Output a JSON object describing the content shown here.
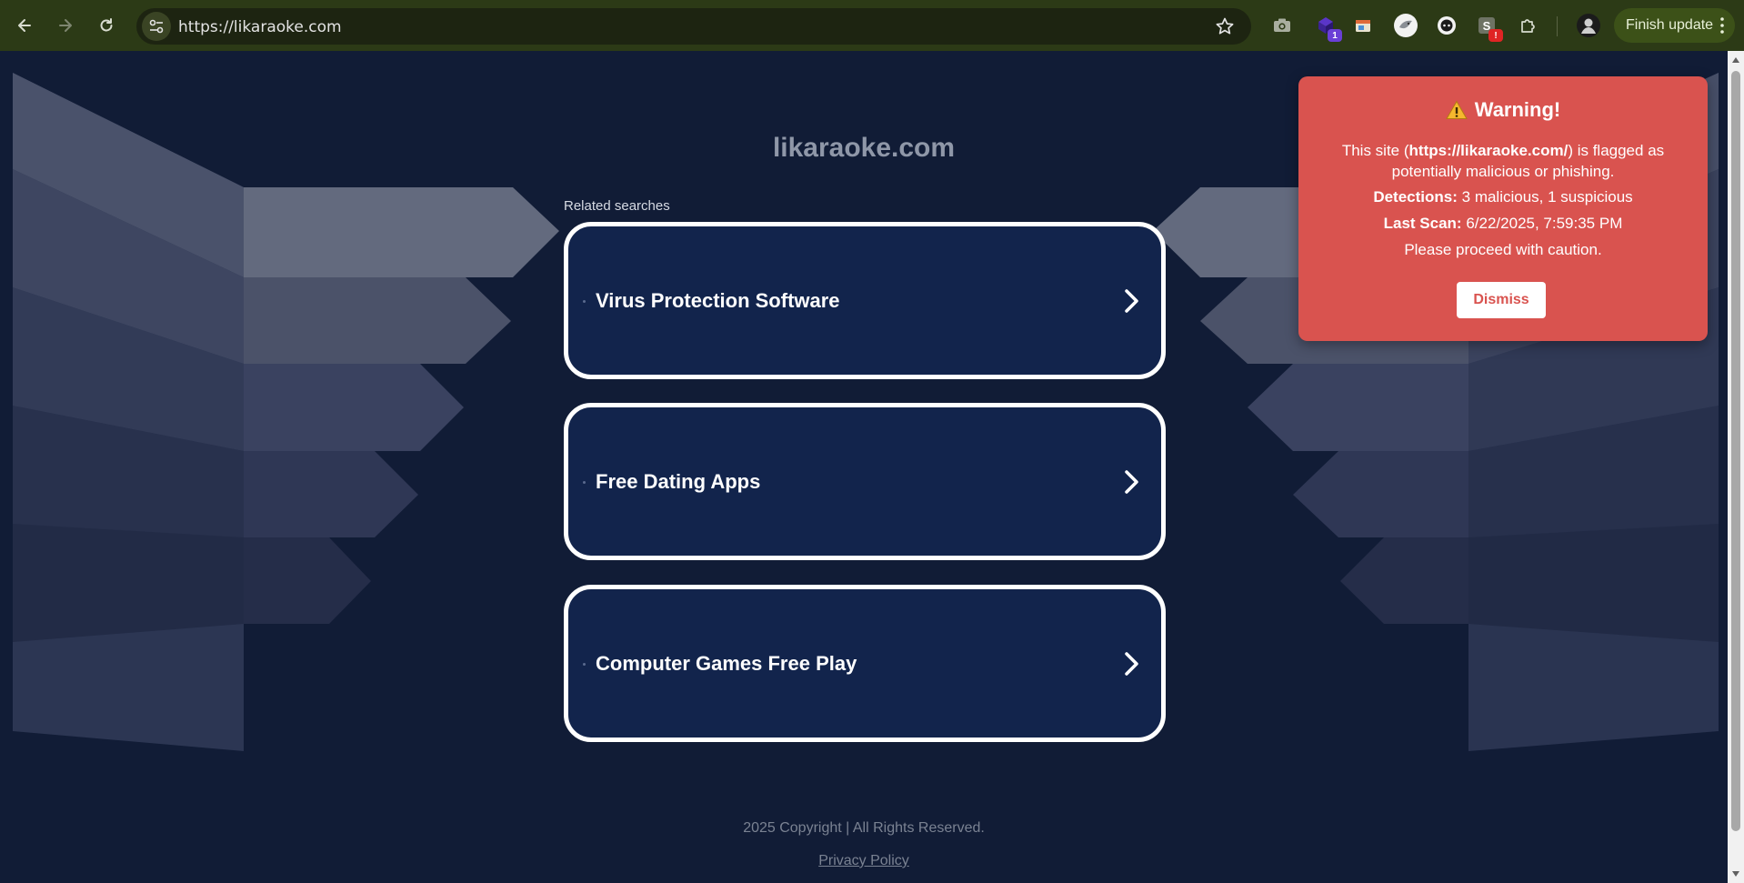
{
  "browser": {
    "url": "https://likaraoke.com",
    "finish_update_label": "Finish update",
    "extensions": [
      {
        "name": "camera-icon"
      },
      {
        "name": "puzzle-badge-icon",
        "badge": "1"
      },
      {
        "name": "window-icon"
      },
      {
        "name": "bird-extension-icon"
      },
      {
        "name": "chat-extension-icon"
      },
      {
        "name": "s-extension-icon",
        "badge": "!"
      },
      {
        "name": "extensions-puzzle-icon"
      }
    ]
  },
  "page": {
    "site_title": "likaraoke.com",
    "related_label": "Related searches",
    "searches": [
      {
        "label": "Virus Protection Software"
      },
      {
        "label": "Free Dating Apps"
      },
      {
        "label": "Computer Games Free Play"
      }
    ],
    "footer_copyright": "2025 Copyright | All Rights Reserved.",
    "footer_privacy": "Privacy Policy"
  },
  "warning": {
    "title": "Warning!",
    "site_prefix": "This site (",
    "site_url": "https://likaraoke.com/",
    "site_suffix": ") is flagged as potentially malicious or phishing.",
    "detections_label": "Detections:",
    "detections_value": "3 malicious, 1 suspicious",
    "last_scan_label": "Last Scan:",
    "last_scan_value": "6/22/2025, 7:59:35 PM",
    "caution": "Please proceed with caution.",
    "dismiss_label": "Dismiss"
  },
  "colors": {
    "page_bg": "#111c36",
    "card_bg": "#12244c",
    "warning_bg": "#d9534f",
    "toolbar_bg": "#2c3a16"
  }
}
